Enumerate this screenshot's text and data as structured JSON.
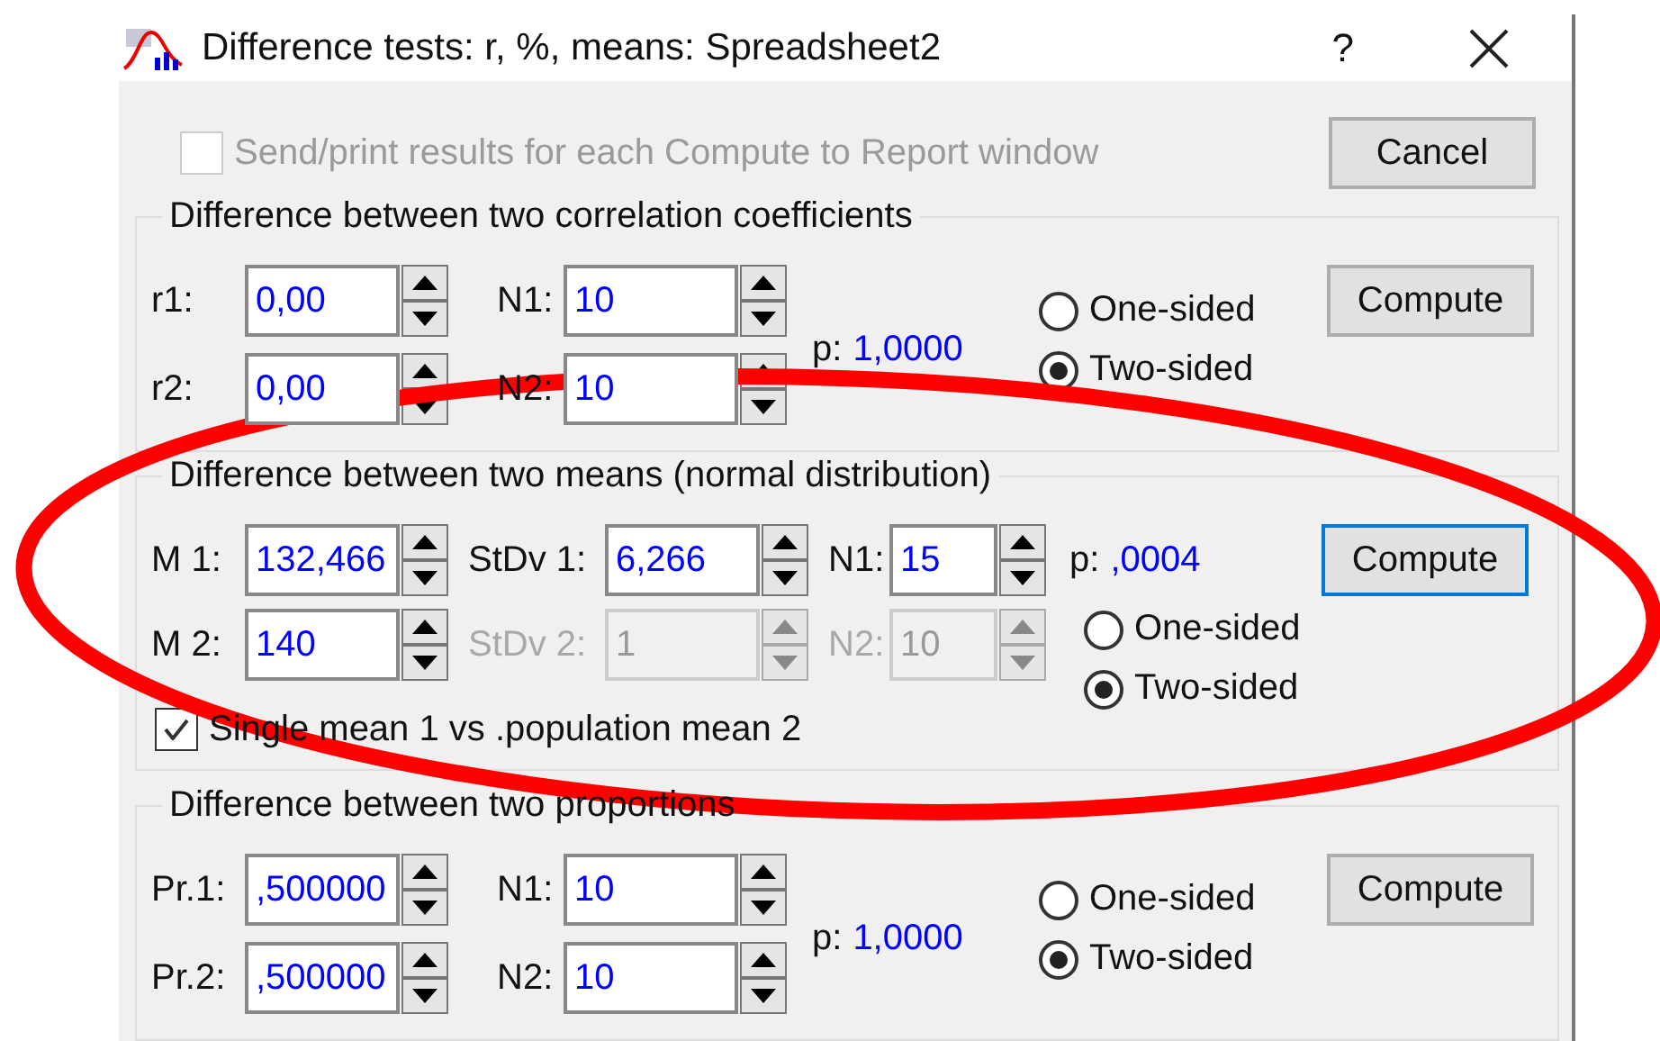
{
  "window": {
    "title": "Difference tests: r, %, means: Spreadsheet2",
    "help": "?"
  },
  "report_option": {
    "label": "Send/print results for each Compute to Report window",
    "checked": false,
    "disabled": true
  },
  "cancel_button": "Cancel",
  "sections": [
    {
      "kind": "pair",
      "title": "Difference between two correlation coefficients",
      "rows": [
        [
          {
            "label": "r1:",
            "value": "0,00",
            "disabled": false
          },
          {
            "label": "N1:",
            "value": "10",
            "disabled": false
          }
        ],
        [
          {
            "label": "r2:",
            "value": "0,00",
            "disabled": false
          },
          {
            "label": "N2:",
            "value": "10",
            "disabled": false
          }
        ]
      ],
      "p_label": "p:",
      "p_value": "1,0000",
      "options": [
        {
          "label": "One-sided",
          "selected": false
        },
        {
          "label": "Two-sided",
          "selected": true
        }
      ],
      "compute": {
        "label": "Compute",
        "focused": false
      }
    },
    {
      "kind": "means",
      "title": "Difference between two means (normal distribution)",
      "rows": [
        [
          {
            "label": "M 1:",
            "value": "132,466",
            "disabled": false
          },
          {
            "label": "StDv 1:",
            "value": "6,266",
            "disabled": false
          },
          {
            "label": "N1:",
            "value": "15",
            "disabled": false
          }
        ],
        [
          {
            "label": "M 2:",
            "value": "140",
            "disabled": false
          },
          {
            "label": "StDv 2:",
            "value": "1",
            "disabled": true
          },
          {
            "label": "N2:",
            "value": "10",
            "disabled": true
          }
        ]
      ],
      "p_label": "p:",
      "p_value": ",0004",
      "options": [
        {
          "label": "One-sided",
          "selected": false
        },
        {
          "label": "Two-sided",
          "selected": true
        }
      ],
      "compute": {
        "label": "Compute",
        "focused": true
      },
      "single_mean": {
        "label": "Single mean 1 vs .population mean 2",
        "checked": true
      }
    },
    {
      "kind": "pair",
      "title": "Difference between two proportions",
      "rows": [
        [
          {
            "label": "Pr.1:",
            "value": ",500000",
            "disabled": false
          },
          {
            "label": "N1:",
            "value": "10",
            "disabled": false
          }
        ],
        [
          {
            "label": "Pr.2:",
            "value": ",500000",
            "disabled": false
          },
          {
            "label": "N2:",
            "value": "10",
            "disabled": false
          }
        ]
      ],
      "p_label": "p:",
      "p_value": "1,0000",
      "options": [
        {
          "label": "One-sided",
          "selected": false
        },
        {
          "label": "Two-sided",
          "selected": true
        }
      ],
      "compute": {
        "label": "Compute",
        "focused": false
      }
    }
  ]
}
